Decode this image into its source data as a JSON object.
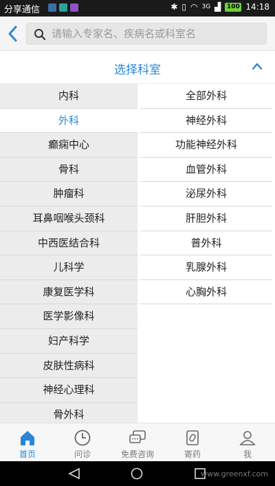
{
  "status": {
    "carrier": "分享通信",
    "time": "14:18",
    "battery": "100",
    "network": "3G"
  },
  "search": {
    "placeholder": "请输入专家名、疾病名或科室名"
  },
  "department": {
    "title": "选择科室"
  },
  "left_items": [
    {
      "label": "内科"
    },
    {
      "label": "外科"
    },
    {
      "label": "癫痫中心"
    },
    {
      "label": "骨科"
    },
    {
      "label": "肿瘤科"
    },
    {
      "label": "耳鼻咽喉头颈科"
    },
    {
      "label": "中西医结合科"
    },
    {
      "label": "儿科学"
    },
    {
      "label": "康复医学科"
    },
    {
      "label": "医学影像科"
    },
    {
      "label": "妇产科学"
    },
    {
      "label": "皮肤性病科"
    },
    {
      "label": "神经心理科"
    },
    {
      "label": "骨外科"
    }
  ],
  "right_items": [
    {
      "label": "全部外科"
    },
    {
      "label": "神经外科"
    },
    {
      "label": "功能神经外科"
    },
    {
      "label": "血管外科"
    },
    {
      "label": "泌尿外科"
    },
    {
      "label": "肝胆外科"
    },
    {
      "label": "普外科"
    },
    {
      "label": "乳腺外科"
    },
    {
      "label": "心胸外科"
    }
  ],
  "nav": {
    "home": "首页",
    "consult": "问诊",
    "free_consult": "免费咨询",
    "medicine": "寄药",
    "me": "我"
  },
  "watermark": "www.greenxf.com",
  "colors": {
    "accent": "#2a86d8",
    "left_bg": "#ececec"
  }
}
